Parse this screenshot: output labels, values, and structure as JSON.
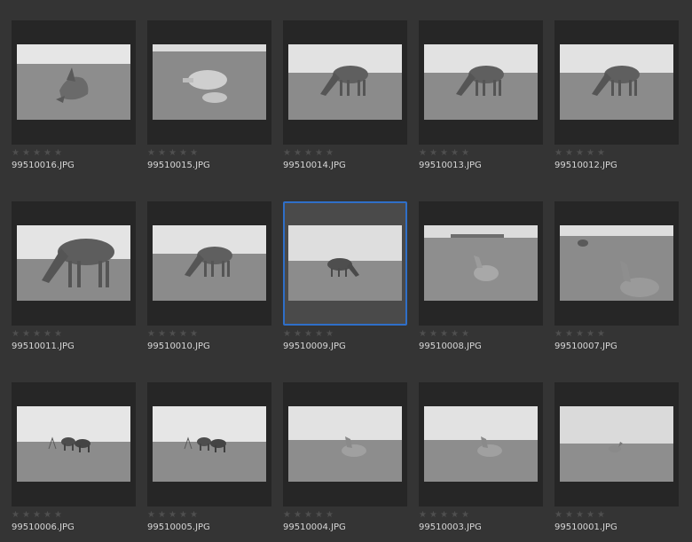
{
  "selected_index": 7,
  "star_glyph": "★",
  "colors": {
    "background": "#343434",
    "card": "#262626",
    "selected_card": "#4a4a4a",
    "selection_border": "#2f6fc8",
    "filename_text": "#d6d6d6",
    "empty_star": "#4f4f4f"
  },
  "thumbnails": [
    {
      "filename": "99510016.JPG",
      "rating": 0,
      "scene": "rolling-horse-on-grass"
    },
    {
      "filename": "99510015.JPG",
      "rating": 0,
      "scene": "pale-horse-lying-down"
    },
    {
      "filename": "99510014.JPG",
      "rating": 0,
      "scene": "horse-grazing"
    },
    {
      "filename": "99510013.JPG",
      "rating": 0,
      "scene": "horse-grazing"
    },
    {
      "filename": "99510012.JPG",
      "rating": 0,
      "scene": "horse-grazing"
    },
    {
      "filename": "99510011.JPG",
      "rating": 0,
      "scene": "horse-grazing-closeup"
    },
    {
      "filename": "99510010.JPG",
      "rating": 0,
      "scene": "horse-grazing"
    },
    {
      "filename": "99510009.JPG",
      "rating": 0,
      "scene": "horse-grazing-distant"
    },
    {
      "filename": "99510008.JPG",
      "rating": 0,
      "scene": "foal-lying-in-field"
    },
    {
      "filename": "99510007.JPG",
      "rating": 0,
      "scene": "horse-lying-in-field"
    },
    {
      "filename": "99510006.JPG",
      "rating": 0,
      "scene": "two-horses-on-plain"
    },
    {
      "filename": "99510005.JPG",
      "rating": 0,
      "scene": "two-horses-on-plain"
    },
    {
      "filename": "99510004.JPG",
      "rating": 0,
      "scene": "horse-lying-on-plain"
    },
    {
      "filename": "99510003.JPG",
      "rating": 0,
      "scene": "horse-lying-on-plain"
    },
    {
      "filename": "99510001.JPG",
      "rating": 0,
      "scene": "horse-lying-far"
    }
  ]
}
